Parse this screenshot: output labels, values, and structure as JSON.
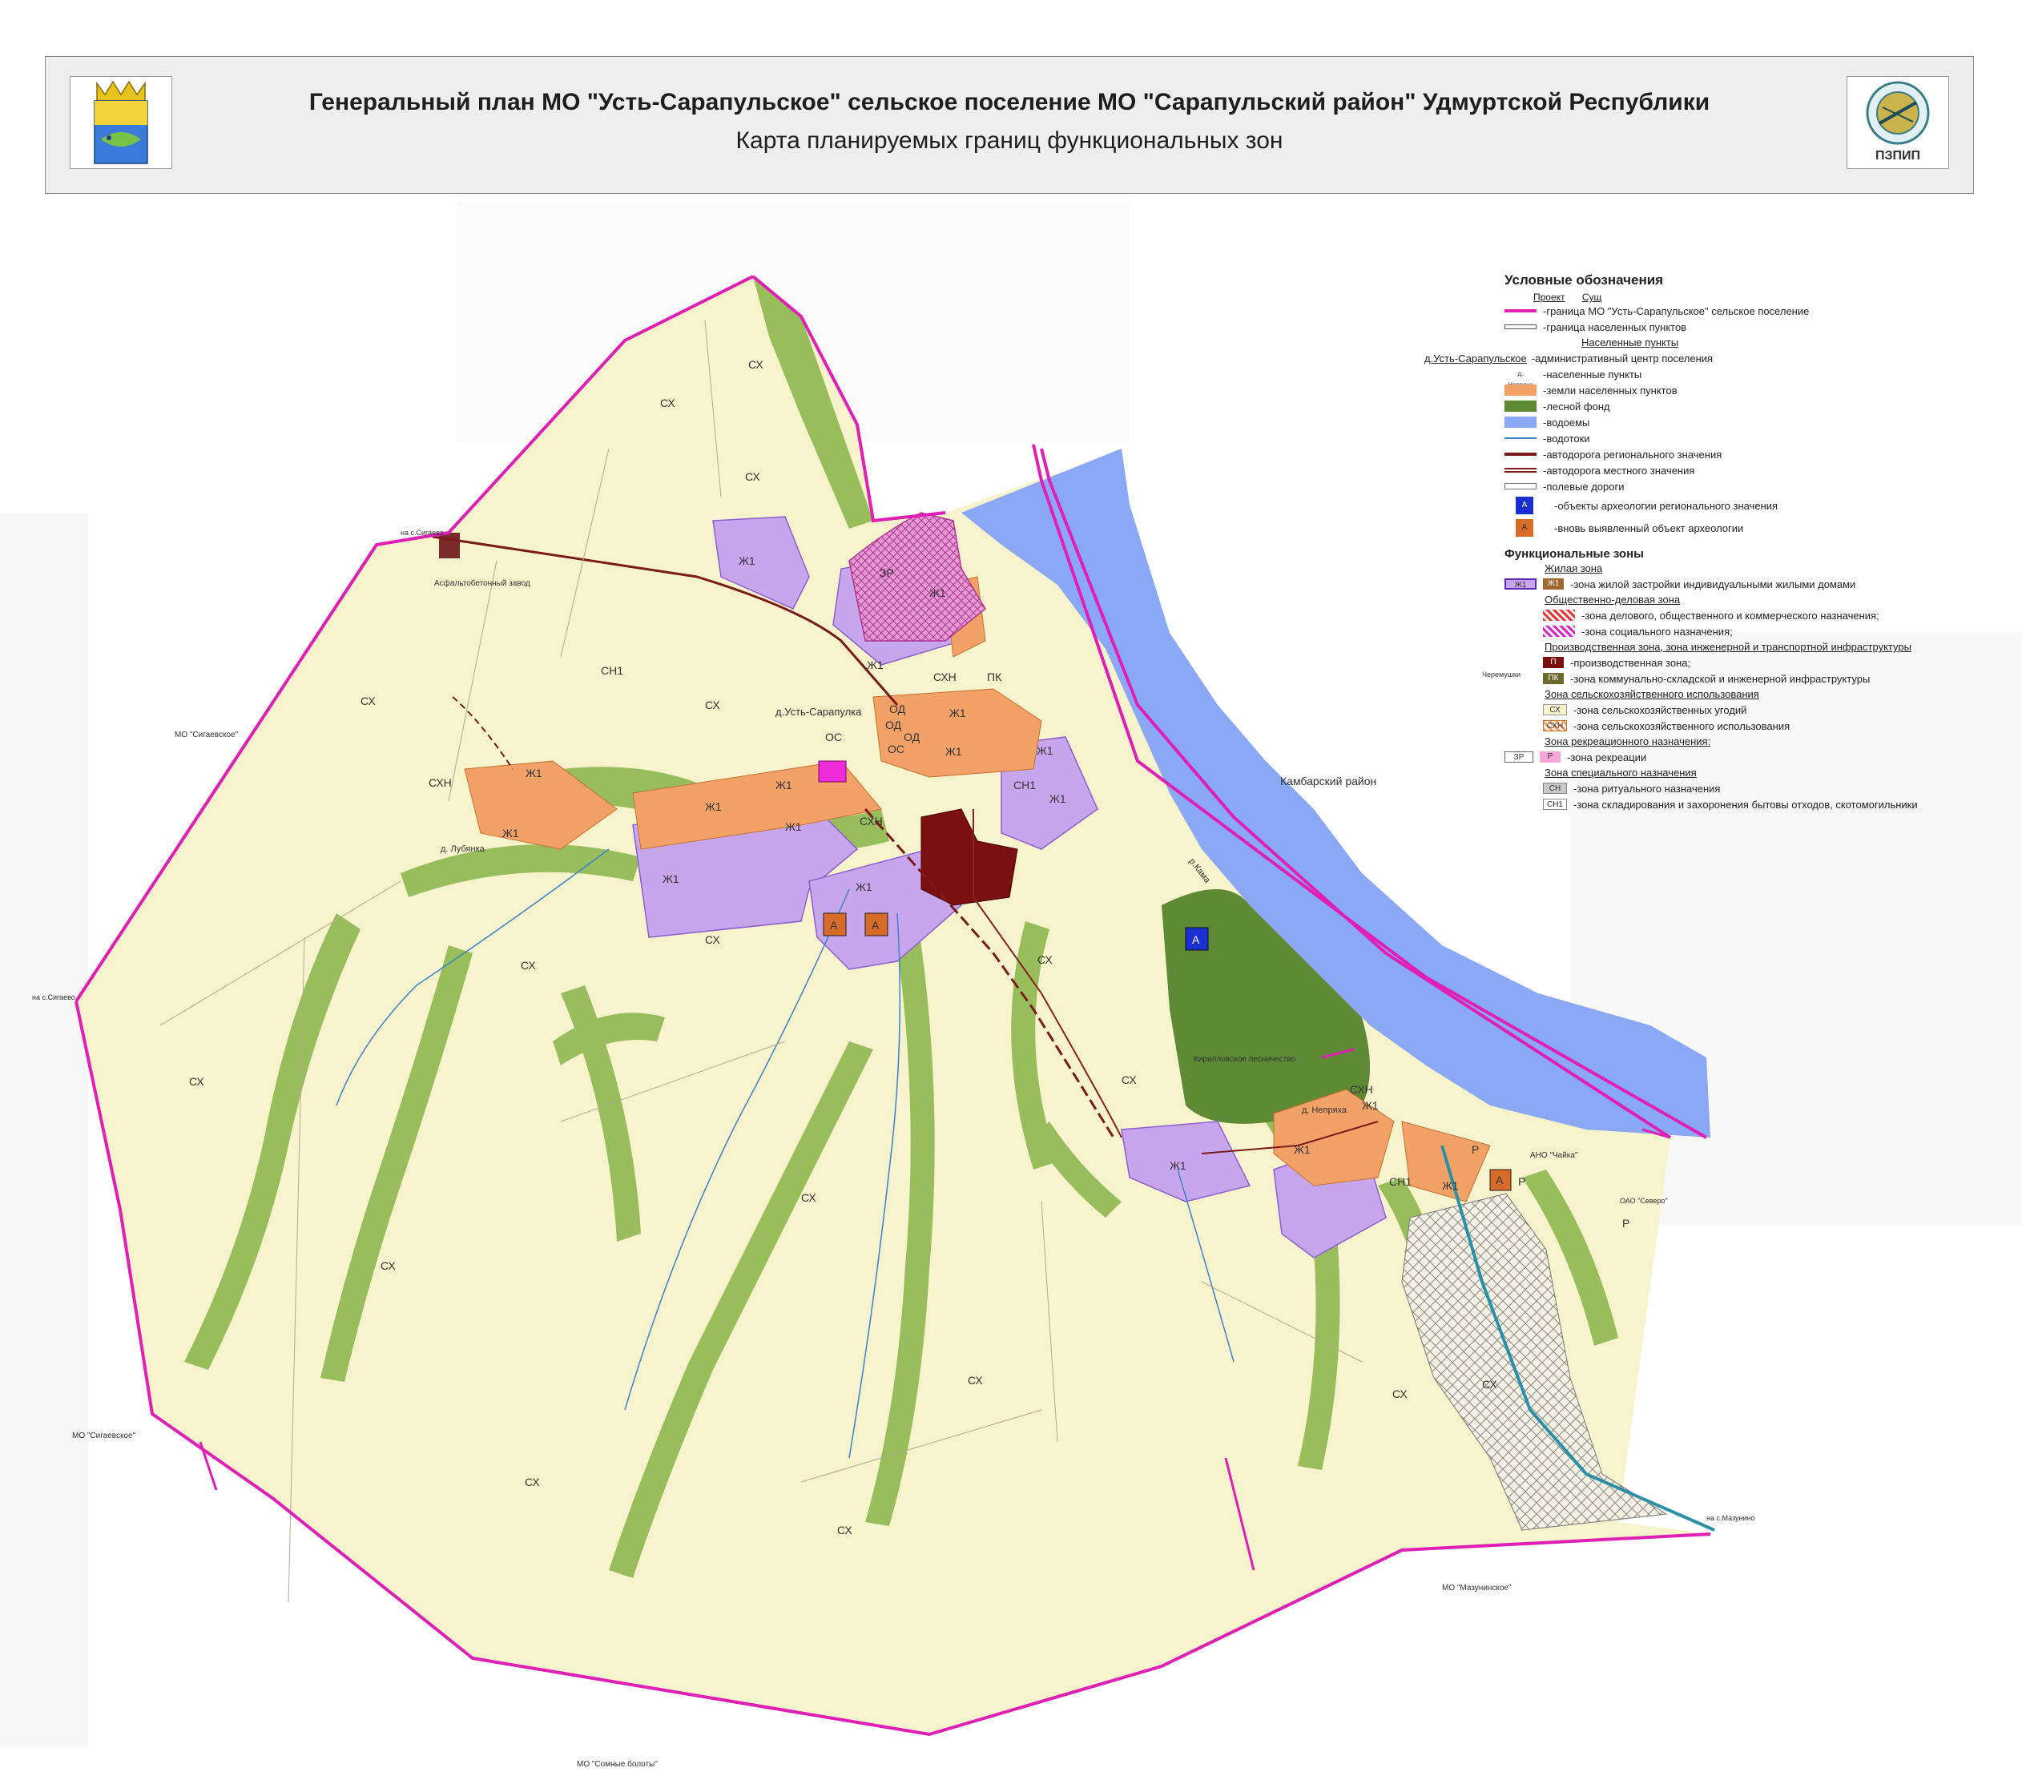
{
  "header": {
    "title": "Генеральный план МО \"Усть-Сарапульское\" сельское поселение  МО \"Сарапульский район\" Удмуртской Республики",
    "subtitle": "Карта планируемых границ функциональных зон",
    "logo_text": "ПЗПИП"
  },
  "colors": {
    "agri": "#f7f3cc",
    "forest": "#8db850",
    "forest_dark": "#5e8a35",
    "water": "#8aa8f5",
    "residential": "#c7a6ee",
    "settlement": "#f3a267",
    "boundary": "#e01fb5",
    "production": "#7a1010",
    "road": "#7a1a1a"
  },
  "legend": {
    "title": "Условные обозначения",
    "col_project": "Проект",
    "col_existing": "Сущ",
    "boundary": "-граница МО \"Усть-Сарапульское\" сельское поселение",
    "settlement_boundary": "-граница населенных пунктов",
    "settlements_header": "Населенные пункты",
    "admin_center_name": "д.Усть-Сарапульское",
    "admin_center": "-административный центр поселения",
    "settlement_sample": "д. Непряха",
    "settlements": "-населенные пункты",
    "settlement_lands": "-земли населенных пунктов",
    "forest": "-лесной фонд",
    "water": "-водоемы",
    "streams": "-водотоки",
    "regional_road": "-автодорога регионального значения",
    "local_road": "-автодорога местного значения",
    "field_roads": "-полевые дороги",
    "arch_regional": "-объекты археологии регионального значения",
    "arch_new": "-вновь выявленный объект археологии",
    "zones_title": "Функциональные зоны",
    "residential_header": "Жилая зона",
    "residential": "-зона жилой застройки индивидуальными жилыми домами",
    "public_header": "Общественно-деловая зона",
    "public_business": "-зона делового, общественного и коммерческого назначения;",
    "public_social": "-зона социального назначения;",
    "industrial_header": "Производственная зона, зона инженерной и транспортной инфраструктуры",
    "industrial": "-производственная зона;",
    "utility": "-зона коммунально-складской и инженерной инфраструктуры",
    "agri_header": "Зона сельскохозяйственного использования",
    "agri_lands": "-зона сельскохозяйственных угодий",
    "agri_use": "-зона сельскохозяйственного использования",
    "recreation_header": "Зона рекреационного назначения:",
    "recreation": "-зона рекреации",
    "special_header": "Зона специального назначения",
    "ritual": "-зона ритуального назначения",
    "waste": "-зона складирования и захоронения бытовы отходов, скотомогильники",
    "codes": {
      "zh1": "Ж1",
      "od": "ОД",
      "os": "ОС",
      "p": "П",
      "pk": "ПК",
      "skh": "СХ",
      "skhn": "СХН",
      "zr": "ЗР",
      "r": "Р",
      "sn": "СН",
      "sn1": "СН1",
      "a": "А"
    }
  },
  "map": {
    "neighbor_kambarka": "Камбарский район",
    "neighbor_sigaevo": "МО \"Сигаевское\"",
    "neighbor_sigaevo_2": "МО \"Сигаевское\"",
    "neighbor_mazunino": "МО \"Мазунинское\"",
    "neighbor_bolgary": "МО \"Сомные болоты\"",
    "settlement_ust": "д.Усть-Сарапулка",
    "settlement_lubenka": "д. Лубянка",
    "settlement_nepryakha": "д. Непряха",
    "asphalt_plant": "Асфальтобетонный завод",
    "forestry": "Кирилловское лесничество",
    "river_kama": "р.Кама",
    "ano_chaika": "АНО \"Чайка\"",
    "oao_label": "ОАО \"Северо\"",
    "label_sigaevo_point": "на с.Сигаево",
    "label_sigaevo_point_2": "на с.Сигаево",
    "label_mazunino_point": "на с.Мазунино",
    "label_chernyshi": "Черемушки"
  }
}
